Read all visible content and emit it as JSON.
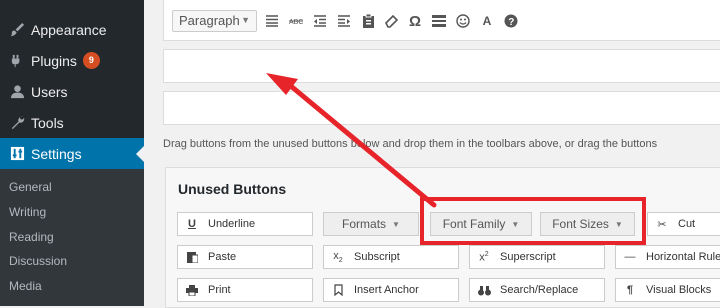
{
  "sidebar": {
    "items": [
      {
        "label": "Appearance",
        "icon": "brush-icon"
      },
      {
        "label": "Plugins",
        "icon": "plugin-icon",
        "badge": "9"
      },
      {
        "label": "Users",
        "icon": "user-icon"
      },
      {
        "label": "Tools",
        "icon": "wrench-icon"
      },
      {
        "label": "Settings",
        "icon": "settings-icon",
        "active": true
      }
    ],
    "submenu": [
      "General",
      "Writing",
      "Reading",
      "Discussion",
      "Media"
    ]
  },
  "toolbar": {
    "format_select": "Paragraph",
    "icons": [
      "align-justify-icon",
      "strikethrough-icon",
      "outdent-icon",
      "indent-icon",
      "paste-icon",
      "eraser-icon",
      "omega-icon",
      "horizontal-rule-icon",
      "smiley-icon",
      "text-color-icon",
      "help-icon"
    ]
  },
  "instruction": "Drag buttons from the unused buttons below and drop them in the toolbars above, or drag the buttons",
  "unused": {
    "title": "Unused Buttons",
    "row1": [
      "Underline",
      "Formats",
      "Font Family",
      "Font Sizes",
      "Cut"
    ],
    "row2": [
      "Paste",
      "Subscript",
      "Superscript",
      "Horizontal Rule"
    ],
    "row3": [
      "Print",
      "Insert Anchor",
      "Search/Replace",
      "Visual Blocks"
    ]
  },
  "colors": {
    "sidebar_bg": "#23282d",
    "active": "#0073aa",
    "highlight": "#e8242b"
  }
}
